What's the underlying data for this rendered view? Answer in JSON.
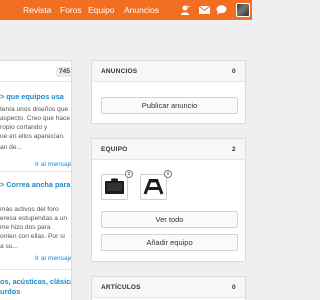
{
  "nav": {
    "items": [
      "Revista",
      "Foros",
      "Equipo",
      "Anuncios"
    ],
    "icons": [
      "user-icon",
      "mail-icon",
      "chat-icon"
    ],
    "accent": "#f26f21"
  },
  "left": {
    "count": "745",
    "threads": [
      {
        "title": "> que equipos usa",
        "snippet": [
          "tenía unos diseños que",
          "aspecto. Creo que hace",
          "ropio cortando y",
          "ue en ellos aparecían.",
          "an de..."
        ],
        "link": "Ir al mensaje"
      },
      {
        "title_lines": [
          "> Correa ancha para",
          ""
        ],
        "snippet": [
          "más activos del foro",
          "eresa estupendas a un",
          "me hizo dos para",
          "onten con ellas. Por si",
          "a su..."
        ],
        "link": "Ir al mensaje"
      },
      {
        "title_lines": [
          "os, acústicas, clásicas y",
          "urdos"
        ]
      }
    ]
  },
  "right": {
    "anuncios": {
      "title": "ANUNCIOS",
      "count": "0",
      "button": "Publicar anuncio"
    },
    "equipo": {
      "title": "EQUIPO",
      "count": "2",
      "close_glyph": "x",
      "buttons": [
        "Ver todo",
        "Añadir equipo"
      ]
    },
    "articulos": {
      "title": "ARTÍCULOS",
      "count": "0"
    }
  }
}
